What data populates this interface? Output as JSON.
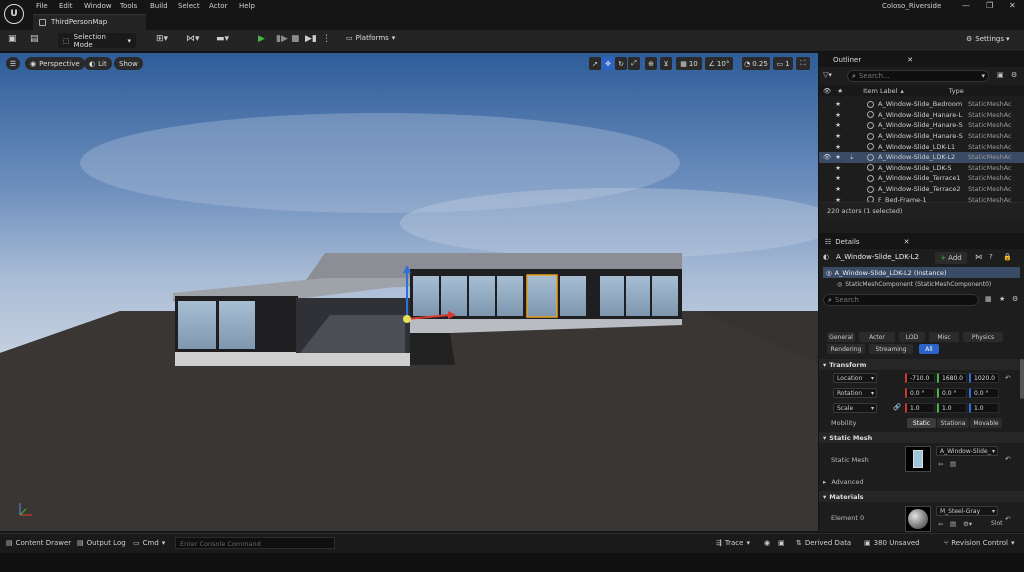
{
  "app": {
    "menu": [
      "File",
      "Edit",
      "Window",
      "Tools",
      "Build",
      "Select",
      "Actor",
      "Help"
    ],
    "map_tab": "ThirdPersonMap",
    "project_name": "Coloso_Riverside",
    "window_buttons": [
      "—",
      "❐",
      "✕"
    ]
  },
  "toolbar": {
    "selection_mode": "Selection Mode",
    "platforms": "Platforms",
    "settings": "Settings"
  },
  "viewport": {
    "perspective": "Perspective",
    "lit": "Lit",
    "show": "Show",
    "grid_snap": "10",
    "rot_snap": "10°",
    "scale_snap": "0.25",
    "cam_speed": "1"
  },
  "outliner": {
    "title": "Outliner",
    "search_placeholder": "Search...",
    "col_label": "Item Label",
    "col_type": "Type",
    "rows": [
      {
        "label": "A_Window-Slide_Bedroom",
        "type": "StaticMeshAc",
        "selected": false
      },
      {
        "label": "A_Window-Slide_Hanare-L",
        "type": "StaticMeshAc",
        "selected": false
      },
      {
        "label": "A_Window-Slide_Hanare-S",
        "type": "StaticMeshAc",
        "selected": false
      },
      {
        "label": "A_Window-Slide_Hanare-S",
        "type": "StaticMeshAc",
        "selected": false
      },
      {
        "label": "A_Window-Slide_LDK-L1",
        "type": "StaticMeshAc",
        "selected": false
      },
      {
        "label": "A_Window-Slide_LDK-L2",
        "type": "StaticMeshAc",
        "selected": true
      },
      {
        "label": "A_Window-Slide_LDK-S",
        "type": "StaticMeshAc",
        "selected": false
      },
      {
        "label": "A_Window-Slide_Terrace1",
        "type": "StaticMeshAc",
        "selected": false
      },
      {
        "label": "A_Window-Slide_Terrace2",
        "type": "StaticMeshAc",
        "selected": false
      },
      {
        "label": "F_Bed-Frame-1",
        "type": "StaticMeshAc",
        "selected": false
      }
    ],
    "actor_count": "220 actors (1 selected)"
  },
  "details": {
    "title": "Details",
    "actor_name": "A_Window-Slide_LDK-L2",
    "add_label": "Add",
    "instance_label": "A_Window-Slide_LDK-L2 (Instance)",
    "component_label": "StaticMeshComponent (StaticMeshComponent0)",
    "search_placeholder": "Search",
    "filters_row1": [
      "General",
      "Actor",
      "LOD",
      "Misc",
      "Physics"
    ],
    "filters_row2": [
      "Rendering",
      "Streaming",
      "All"
    ],
    "transform": {
      "section": "Transform",
      "location_label": "Location",
      "location": [
        "-710.0",
        "1680.0",
        "1020.0"
      ],
      "rotation_label": "Rotation",
      "rotation": [
        "0.0 °",
        "0.0 °",
        "0.0 °"
      ],
      "scale_label": "Scale",
      "scale": [
        "1.0",
        "1.0",
        "1.0"
      ],
      "mobility_label": "Mobility",
      "mobility": [
        "Static",
        "Stationa",
        "Movable"
      ]
    },
    "static_mesh": {
      "section": "Static Mesh",
      "label": "Static Mesh",
      "value": "A_Window-Slide_"
    },
    "advanced": "Advanced",
    "materials": {
      "section": "Materials",
      "element_label": "Element 0",
      "value": "M_Steel-Gray",
      "slot": "Slot"
    }
  },
  "statusbar": {
    "content_drawer": "Content Drawer",
    "output_log": "Output Log",
    "cmd": "Cmd",
    "console_placeholder": "Enter Console Command",
    "trace": "Trace",
    "derived_data": "Derived Data",
    "unsaved": "380 Unsaved",
    "revision_control": "Revision Control"
  },
  "colors": {
    "accent": "#2c63c7",
    "selection": "#3a4b66",
    "play_green": "#49b449",
    "gizmo_orange": "#e8a020"
  }
}
